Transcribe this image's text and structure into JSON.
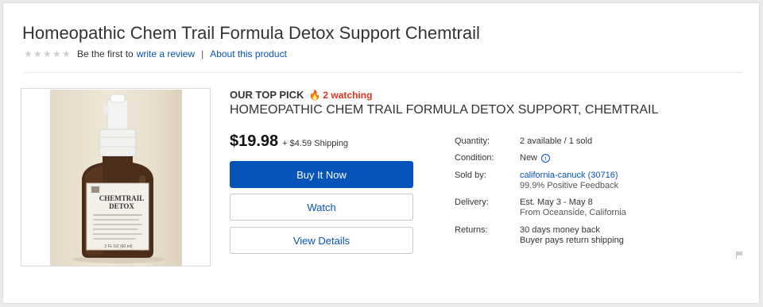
{
  "product": {
    "title": "Homeopathic Chem Trail Formula Detox Support Chemtrail",
    "subtitle": "HOMEOPATHIC CHEM TRAIL FORMULA DETOX SUPPORT, CHEMTRAIL",
    "rating_stars": 0
  },
  "reviews": {
    "prefix": "Be the first to",
    "write_review_link": "write a review",
    "separator": "|",
    "about_link": "About this product"
  },
  "badge": {
    "top_pick": "OUR TOP PICK",
    "watching": "2 watching"
  },
  "pricing": {
    "price": "$19.98",
    "shipping": "+ $4.59 Shipping"
  },
  "buttons": {
    "buy_now": "Buy It Now",
    "watch": "Watch",
    "view_details": "View Details"
  },
  "details": {
    "quantity_label": "Quantity:",
    "quantity_value": "2 available / 1 sold",
    "condition_label": "Condition:",
    "condition_value": "New",
    "sold_by_label": "Sold by:",
    "seller_name": "california-canuck (30716)",
    "seller_feedback": "99.9% Positive Feedback",
    "delivery_label": "Delivery:",
    "delivery_estimate": "Est. May 3 - May 8",
    "delivery_from": "From Oceanside, California",
    "returns_label": "Returns:",
    "returns_policy": "30 days money back",
    "returns_shipping": "Buyer pays return shipping"
  },
  "label_lettering": {
    "line1": "CHEMTRAIL",
    "line2": "DETOX",
    "bottom": "2 FL OZ (60 ml)"
  },
  "icons": {
    "star": "star-icon",
    "flame": "flame-icon",
    "info": "info-icon",
    "flag": "flag-icon"
  },
  "colors": {
    "link_blue": "#0654ba",
    "watching_red": "#e0301e",
    "button_blue": "#0654ba"
  }
}
